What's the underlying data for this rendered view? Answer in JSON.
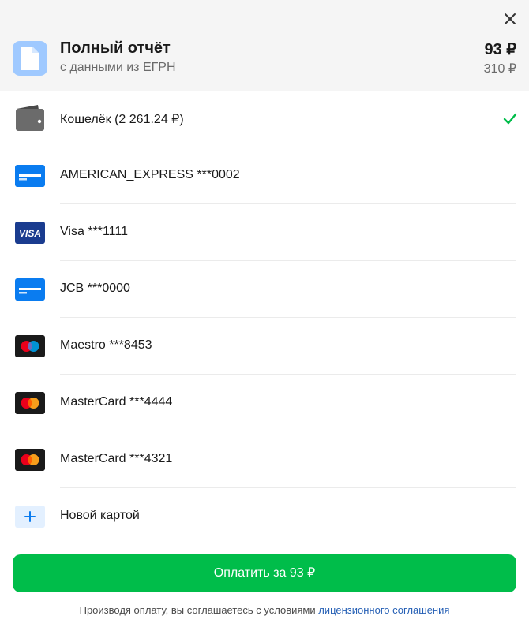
{
  "header": {
    "close_icon": "close-icon",
    "doc_icon": "document-icon",
    "title": "Полный отчёт",
    "subtitle": "с данными из ЕГРН",
    "price": "93 ₽",
    "old_price": "310 ₽"
  },
  "colors": {
    "header_bg": "#f5f5f5",
    "accent_green": "#00bd4a",
    "link_blue": "#2660b5",
    "card_blue": "#0a7cf0",
    "visa_blue": "#1a3c8f"
  },
  "payment_methods": [
    {
      "label": "Кошелёк (2 261.24 ₽)",
      "icon": "wallet-icon",
      "selected": true
    },
    {
      "label": "AMERICAN_EXPRESS ***0002",
      "icon": "card-icon",
      "selected": false
    },
    {
      "label": "Visa ***1111",
      "icon": "visa-icon",
      "icon_text": "VISA",
      "selected": false
    },
    {
      "label": "JCB ***0000",
      "icon": "card-icon",
      "selected": false
    },
    {
      "label": "Maestro ***8453",
      "icon": "maestro-icon",
      "selected": false
    },
    {
      "label": "MasterCard ***4444",
      "icon": "mastercard-icon",
      "selected": false
    },
    {
      "label": "MasterCard ***4321",
      "icon": "mastercard-icon",
      "selected": false
    },
    {
      "label": "Новой картой",
      "icon": "plus-icon",
      "selected": false
    }
  ],
  "pay_button": {
    "label": "Оплатить за 93 ₽"
  },
  "terms": {
    "text": "Производя оплату, вы соглашаетесь с условиями ",
    "link": "лицензионного соглашения"
  }
}
